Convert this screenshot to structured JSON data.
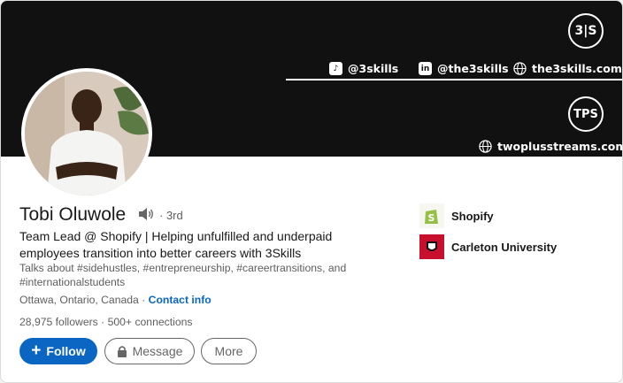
{
  "banner": {
    "badge_top": "3|S",
    "badge_bottom": "TPS",
    "socials": [
      {
        "icon": "tiktok-icon",
        "label": "@3skills"
      },
      {
        "icon": "linkedin-icon",
        "label": "@the3skills"
      },
      {
        "icon": "globe-icon",
        "label": "the3skills.com"
      }
    ],
    "website2": "twoplusstreams.com"
  },
  "profile": {
    "name": "Tobi Oluwole",
    "degree": "· 3rd",
    "headline": "Team Lead @ Shopify | Helping unfulfilled and underpaid employees transition into better careers with 3Skills",
    "talks_about": "Talks about #sidehustles, #entrepreneurship, #careertransitions, and #internationalstudents",
    "location": "Ottawa, Ontario, Canada ·",
    "contact_info": "Contact info",
    "followers": "28,975 followers",
    "connections": "· 500+ connections"
  },
  "actions": {
    "follow": "Follow",
    "message": "Message",
    "more": "More"
  },
  "orgs": [
    {
      "name": "Shopify",
      "icon": "shopify-logo-icon",
      "color": "#95bf47"
    },
    {
      "name": "Carleton University",
      "icon": "carleton-logo-icon",
      "color": "#c8102e"
    }
  ],
  "colors": {
    "accent": "#0a66c2",
    "banner": "#111111"
  }
}
